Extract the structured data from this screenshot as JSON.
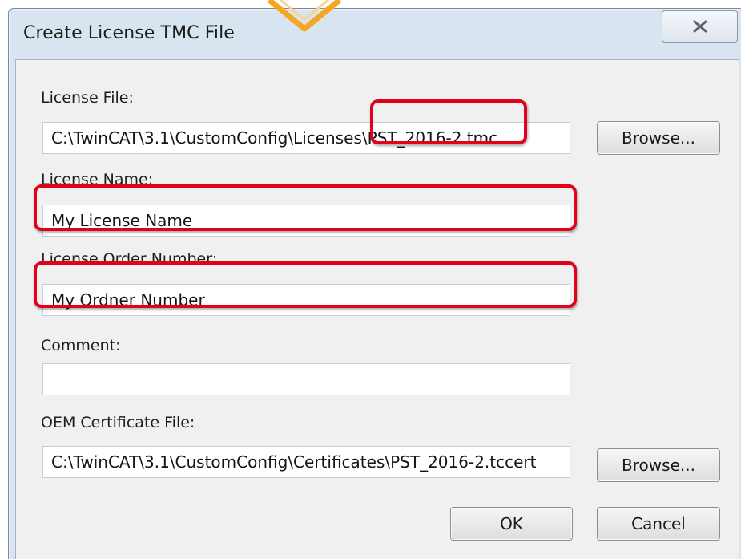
{
  "window": {
    "title": "Create License TMC File",
    "close_icon": "close-x-icon"
  },
  "form": {
    "license_file_label": "License File:",
    "license_file_path_prefix": "C:\\TwinCAT\\3.1\\CustomConfig\\Licenses",
    "license_file_name": "\\PST_2016-2.tmc",
    "license_name_label": "License Name:",
    "license_name_value": "My License Name",
    "order_number_label": "License Order Number:",
    "order_number_value": "My Ordner Number",
    "comment_label": "Comment:",
    "comment_value": "",
    "oem_cert_label": "OEM Certificate File:",
    "oem_cert_value": "C:\\TwinCAT\\3.1\\CustomConfig\\Certificates\\PST_2016-2.tccert"
  },
  "buttons": {
    "browse_license": "Browse...",
    "browse_cert": "Browse...",
    "ok": "OK",
    "cancel": "Cancel"
  },
  "annotations": {
    "highlight_color": "#e3001b",
    "arrow_color": "#f5a623"
  }
}
